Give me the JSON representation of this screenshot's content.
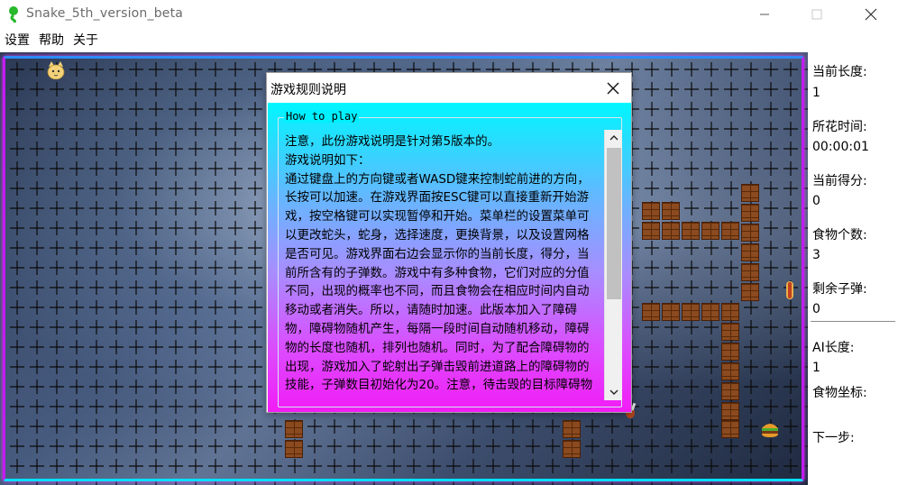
{
  "window": {
    "title": "Snake_5th_version_beta",
    "icon": "green-snake-icon"
  },
  "menu": {
    "items": [
      {
        "label": "设置"
      },
      {
        "label": "帮助"
      },
      {
        "label": "关于"
      }
    ]
  },
  "panel": {
    "length_label": "当前长度:",
    "length_value": "1",
    "time_label": "所花时间:",
    "time_value": "00:00:01",
    "score_label": "当前得分:",
    "score_value": "0",
    "food_label": "食物个数:",
    "food_value": "3",
    "bullets_label": "剩余子弹:",
    "bullets_value": "0",
    "ai_length_label": "AI长度:",
    "ai_length_value": "1",
    "food_coord_label": "食物坐标:",
    "next_step_label": "下一步:"
  },
  "dialog": {
    "title": "游戏规则说明",
    "group_label": "How to play",
    "text": "注意，此份游戏说明是针对第5版本的。\n游戏说明如下：\n通过键盘上的方向键或者WASD键来控制蛇前进的方向，长按可以加速。在游戏界面按ESC键可以直接重新开始游戏，按空格键可以实现暂停和开始。菜单栏的设置菜单可以更改蛇头，蛇身，选择速度，更换背景，以及设置网格是否可见。游戏界面右边会显示你的当前长度，得分，当前所含有的子弹数。游戏中有多种食物，它们对应的分值不同，出现的概率也不同，而且食物会在相应时间内自动移动或者消失。所以，请随时加速。此版本加入了障碍物，障碍物随机产生，每隔一段时间自动随机移动，障碍物的长度也随机，排列也随机。同时，为了配合障碍物的出现，游戏加入了蛇射出子弹击毁前进道路上的障碍物的技能，子弹数目初始化为20。注意，待击毁的目标障碍物"
  },
  "colors": {
    "border_magenta": "#c21cf0",
    "dialog_top": "#00f6ff",
    "dialog_bottom": "#f21cf6",
    "brick": "#8b4a1f"
  }
}
